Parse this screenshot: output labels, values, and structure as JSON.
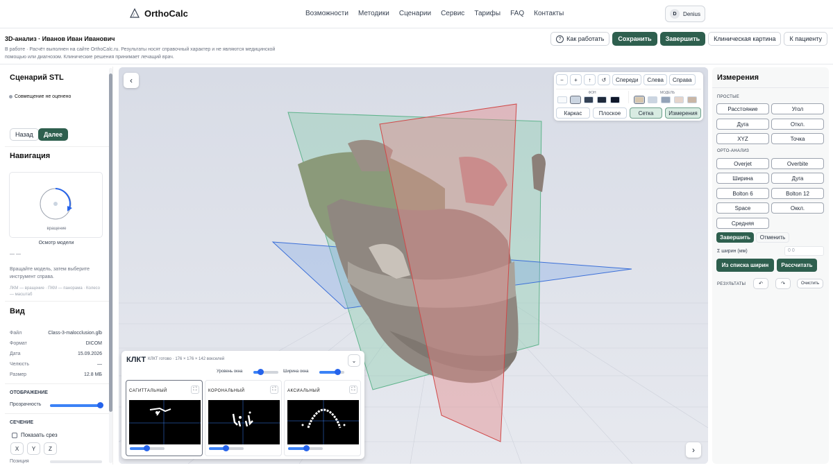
{
  "app": {
    "logo": "OrthoCalc"
  },
  "nav": [
    "Возможности",
    "Методики",
    "Сценарии",
    "Сервис",
    "Тарифы",
    "FAQ",
    "Контакты"
  ],
  "user": {
    "initial": "D",
    "name": "Denius"
  },
  "page": {
    "title": "3D-анализ · Иванов Иван Иванович",
    "note": "В работе · Расчёт выполнен на сайте OrthoCalc.ru. Результаты носят справочный характер и не являются медицинской помощью или диагнозом. Клинические решения принимает лечащий врач.",
    "actions": {
      "how": "Как работать",
      "save": "Сохранить",
      "finish": "Завершить",
      "clinical": "Клиническая картина",
      "patient": "К пациенту"
    }
  },
  "left": {
    "scenario_title": "Сценарий STL",
    "status": "Совмещение не оценено",
    "back": "Назад",
    "next": "Далее",
    "nav_title": "Навигация",
    "rotation_label": "вращение",
    "inspect_label": "Осмотр модели",
    "dashes": "— —",
    "hint": "Вращайте модель, затем выберите инструмент справа.",
    "mouse_hint": "ЛКМ — вращение · ПКМ — панорама · Колесо — масштаб",
    "view_title": "Вид",
    "props": [
      {
        "k": "Файл",
        "v": "Class-3-malocclusion.glb"
      },
      {
        "k": "Формат",
        "v": "DICOM"
      },
      {
        "k": "Дата",
        "v": "15.09.2026"
      },
      {
        "k": "Челюсть",
        "v": "—"
      },
      {
        "k": "Размер",
        "v": "12.8 МБ"
      }
    ],
    "display_title": "ОТОБРАЖЕНИЕ",
    "transparency": "Прозрачность",
    "transparency_value": 1.0,
    "section_title": "СЕЧЕНИЕ",
    "show_slice": "Показать срез",
    "axes": [
      "X",
      "Y",
      "Z"
    ],
    "position": "Позиция"
  },
  "viewport": {
    "toolbar": {
      "zoom_out": "−",
      "zoom_in": "+",
      "up": "↑",
      "reset": "↺",
      "front": "Спереди",
      "left": "Слева",
      "right": "Справа"
    },
    "bg_label": "ФОН",
    "model_label": "МОДЕЛЬ",
    "bg_colors": [
      "#f8fafc",
      "#cbd5e1",
      "#334155",
      "#1e293b",
      "#0f172a"
    ],
    "model_colors": [
      "#d6c6ae",
      "#cbd5e1",
      "#94a3b8",
      "#e5d5cc",
      "#c9b6a6"
    ],
    "modes": [
      "Каркас",
      "Плоское",
      "Сетка",
      "Измерения"
    ]
  },
  "klkt": {
    "title": "КЛКТ",
    "status": "КЛКТ готово · 176 × 176 × 142 вокселей",
    "window_level": "Уровень окна",
    "window_width": "Ширина окна",
    "window_level_value": 0.3,
    "window_width_value": 0.75,
    "panels": [
      {
        "name": "САГИТТАЛЬНЫЙ",
        "slider": 0.45
      },
      {
        "name": "КОРОНАЛЬНЫЙ",
        "slider": 0.45
      },
      {
        "name": "АКСИАЛЬНЫЙ",
        "slider": 0.5
      }
    ]
  },
  "right": {
    "title": "Измерения",
    "simple_label": "ПРОСТЫЕ",
    "simple": [
      "Расстояние",
      "Угол",
      "Дуга",
      "Откл.",
      "XYZ",
      "Точка"
    ],
    "ortho_label": "ОРТО-АНАЛИЗ",
    "ortho": [
      "Overjet",
      "Overbite",
      "Ширина",
      "Дуга",
      "Bolton 6",
      "Bolton 12",
      "Space",
      "Оккл.",
      "Средняя"
    ],
    "finish": "Завершить",
    "cancel": "Отменить",
    "sum_label": "Σ ширин (мм)",
    "sum_value": "0 0",
    "from_list": "Из списка ширин",
    "calculate": "Рассчитать",
    "results": "РЕЗУЛЬТАТЫ",
    "clear": "Очистить"
  },
  "colors": {
    "accent": "#2e5f4e",
    "slider": "#2563eb"
  }
}
